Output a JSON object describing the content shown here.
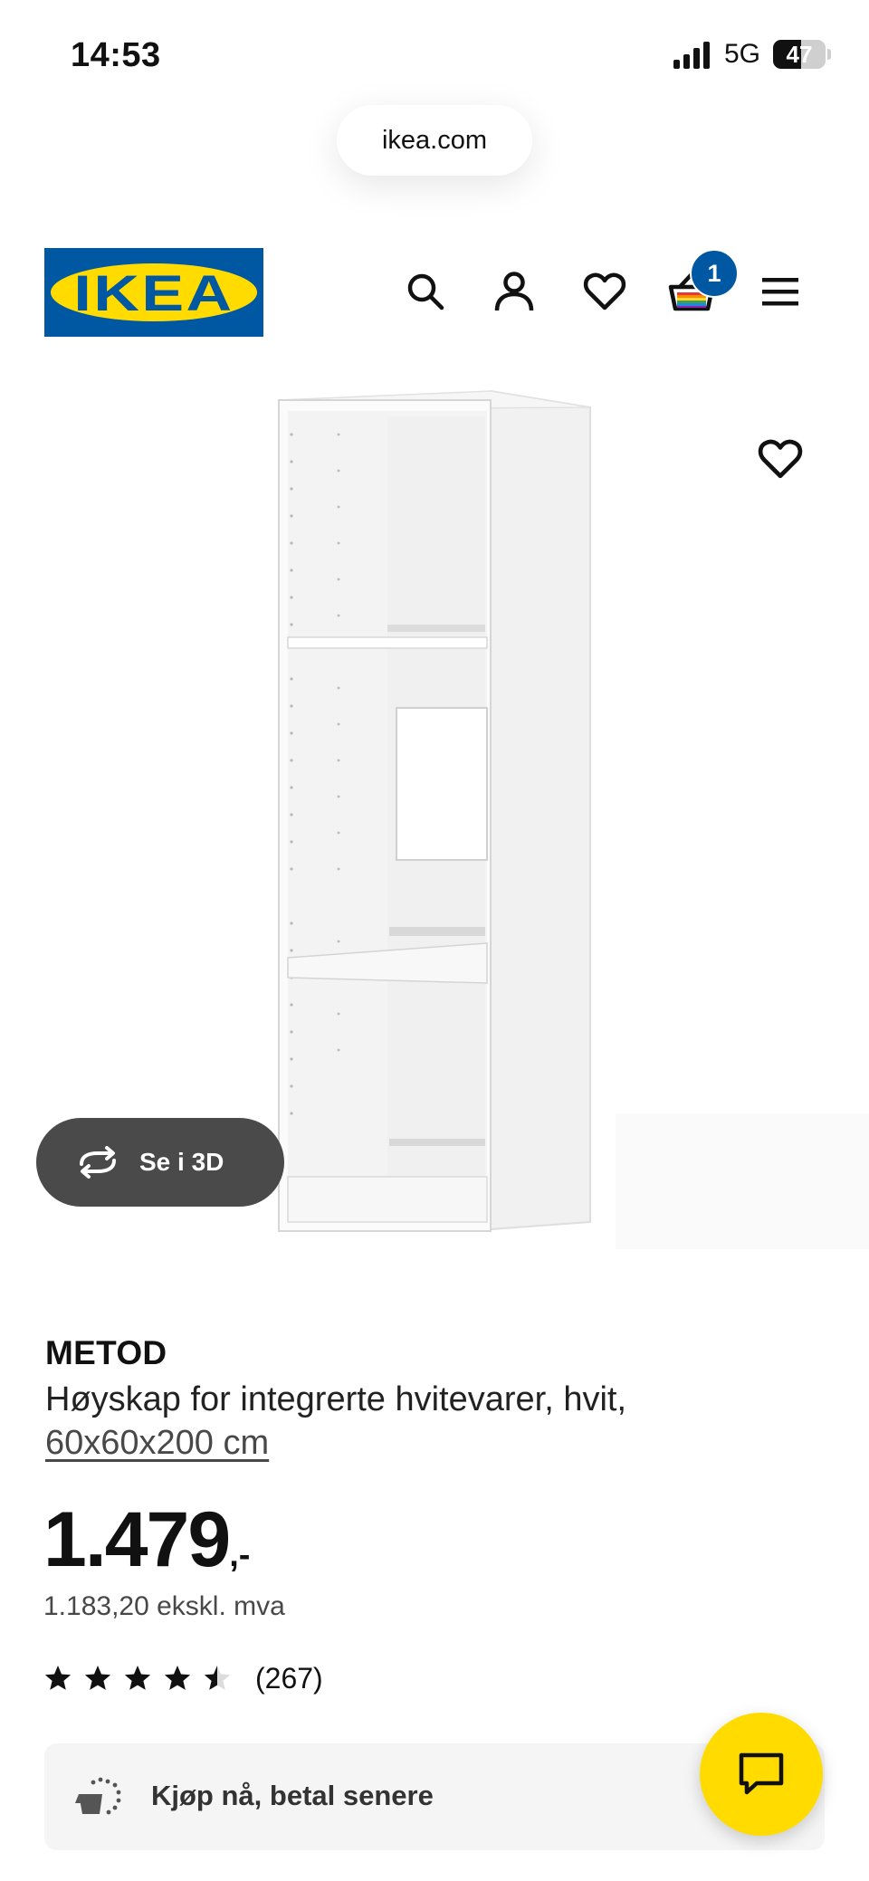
{
  "status_bar": {
    "time": "14:53",
    "network": "5G",
    "battery": "47",
    "battery_level_percent": 47
  },
  "browser": {
    "url": "ikea.com"
  },
  "header": {
    "logo_text": "IKEA",
    "cart_count": "1",
    "icons": [
      "search-icon",
      "account-icon",
      "heart-icon",
      "shopping-basket-icon",
      "hamburger-menu-icon"
    ]
  },
  "product": {
    "see_3d_label": "Se i 3D",
    "brand": "METOD",
    "description": "Høyskap for integrerte hvitevarer, hvit,",
    "dimensions": "60x60x200 cm",
    "price": "1.479",
    "price_suffix": ",-",
    "price_ex_vat": "1.183,20 ekskl. mva",
    "rating": 4.5,
    "review_count": "(267)"
  },
  "payment": {
    "klarna_label": "Kjøp nå, betal senere"
  },
  "colors": {
    "ikea_blue": "#0058a3",
    "ikea_yellow": "#ffdb00",
    "pill_dark": "#4a4a4a"
  }
}
